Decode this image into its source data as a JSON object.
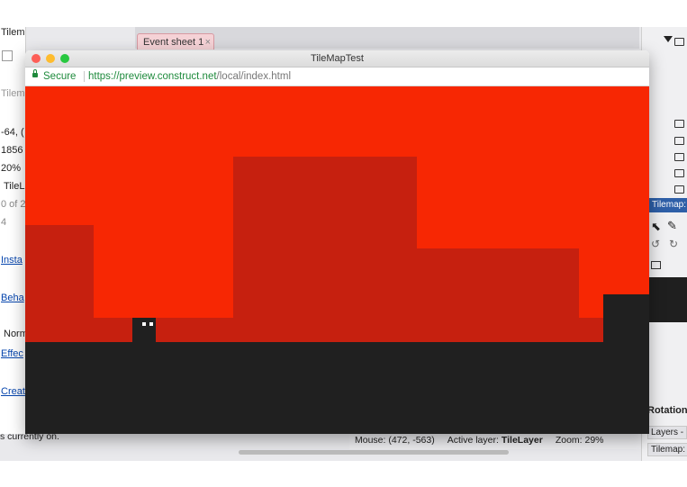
{
  "editor": {
    "left_panel": {
      "rows": [
        "Tilem",
        "Tilem",
        "-64, (",
        "1856",
        "20%",
        "TileL",
        "0 of 2",
        "4",
        "Insta",
        "Beha",
        "Norm",
        "Effec",
        "Creat"
      ],
      "link_rows": [
        8,
        9,
        11,
        12
      ]
    },
    "tab": {
      "label": "Event sheet 1",
      "close_icon": "×"
    },
    "right_panel": {
      "tilemap_label": "Tilemap: T",
      "rotation_label": "Rotation",
      "layers_tab": "Layers -",
      "tilemap_tab": "Tilemap:"
    },
    "status_bar": {
      "mouse": "Mouse: (472, -563)",
      "active_layer_label": "Active layer:",
      "active_layer_value": "TileLayer",
      "zoom": "Zoom: 29%"
    },
    "status_left": "s currently on."
  },
  "browser": {
    "title": "TileMapTest",
    "secure_label": "Secure",
    "url_scheme_host": "https://preview.construct.net",
    "url_path": "/local/index.html",
    "colors": {
      "close": "#fd5f57",
      "minimize": "#febc2e",
      "maximize": "#28c840"
    }
  },
  "game": {
    "colors": {
      "sky": "#f72703",
      "blocks": "#c6200f",
      "ground": "#202020",
      "player_eyes": "#ffffff"
    }
  }
}
